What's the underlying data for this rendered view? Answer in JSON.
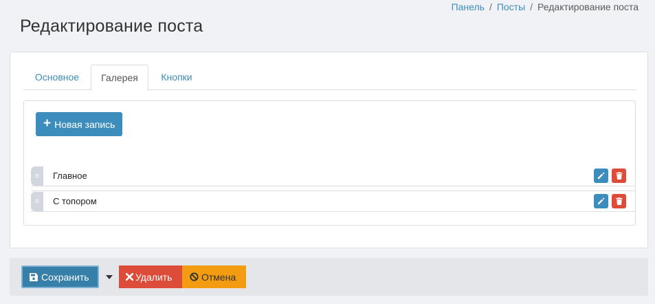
{
  "breadcrumb": {
    "items": [
      "Панель",
      "Посты",
      "Редактирование поста"
    ],
    "separator": "/"
  },
  "page": {
    "title": "Редактирование поста"
  },
  "tabs": [
    "Основное",
    "Галерея",
    "Кнопки"
  ],
  "active_tab": "Галерея",
  "gallery": {
    "new_button_label": "Новая запись",
    "entries": [
      "Главное",
      "С топором"
    ]
  },
  "footer": {
    "save_label": "Сохранить",
    "delete_label": "Удалить",
    "cancel_label": "Отмена"
  },
  "colors": {
    "primary": "#3c8dbc",
    "danger": "#dd4b39",
    "warning": "#f39c12"
  },
  "icons": [
    "plus-icon",
    "drag-handle-icon",
    "pencil-icon",
    "trash-icon",
    "floppy-disk-icon",
    "caret-down-icon",
    "times-icon",
    "ban-icon"
  ]
}
